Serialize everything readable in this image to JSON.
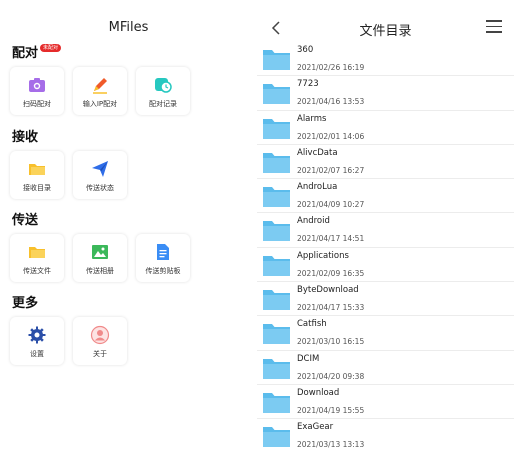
{
  "left": {
    "app_title": "MFiles",
    "pair": {
      "title": "配对",
      "badge": "未配对",
      "items": [
        {
          "label": "扫码配对",
          "icon": "scan-camera-icon"
        },
        {
          "label": "输入IP配对",
          "icon": "pencil-icon"
        },
        {
          "label": "配对记录",
          "icon": "clock-icon"
        }
      ]
    },
    "receive": {
      "title": "接收",
      "items": [
        {
          "label": "接收目录",
          "icon": "folder-icon"
        },
        {
          "label": "传送状态",
          "icon": "paper-plane-icon"
        }
      ]
    },
    "send": {
      "title": "传送",
      "items": [
        {
          "label": "传送文件",
          "icon": "folder-icon"
        },
        {
          "label": "传送相册",
          "icon": "image-icon"
        },
        {
          "label": "传送剪贴板",
          "icon": "document-icon"
        }
      ]
    },
    "more": {
      "title": "更多",
      "items": [
        {
          "label": "设置",
          "icon": "gear-icon"
        },
        {
          "label": "关于",
          "icon": "user-icon"
        }
      ]
    }
  },
  "right": {
    "title": "文件目录",
    "folders": [
      {
        "name": "360",
        "date": "2021/02/26 16:19"
      },
      {
        "name": "7723",
        "date": "2021/04/16 13:53"
      },
      {
        "name": "Alarms",
        "date": "2021/02/01 14:06"
      },
      {
        "name": "AlivcData",
        "date": "2021/02/07 16:27"
      },
      {
        "name": "AndroLua",
        "date": "2021/04/09 10:27"
      },
      {
        "name": "Android",
        "date": "2021/04/17 14:51"
      },
      {
        "name": "Applications",
        "date": "2021/02/09 16:35"
      },
      {
        "name": "ByteDownload",
        "date": "2021/04/17 15:33"
      },
      {
        "name": "Catfish",
        "date": "2021/03/10 16:15"
      },
      {
        "name": "DCIM",
        "date": "2021/04/20 09:38"
      },
      {
        "name": "Download",
        "date": "2021/04/19 15:55"
      },
      {
        "name": "ExaGear",
        "date": "2021/03/13 13:13"
      }
    ]
  },
  "colors": {
    "folder": "#5bbcec",
    "badge": "#e52b2b",
    "scan": "#a66de8",
    "pencil": "#f05a2a",
    "clock": "#27c8c0",
    "folder_yellow": "#f8c02c",
    "plane": "#2f6de8",
    "image": "#3bb85a",
    "doc": "#3a8df5",
    "gear": "#2b4fa8",
    "user": "#f08a8a"
  }
}
